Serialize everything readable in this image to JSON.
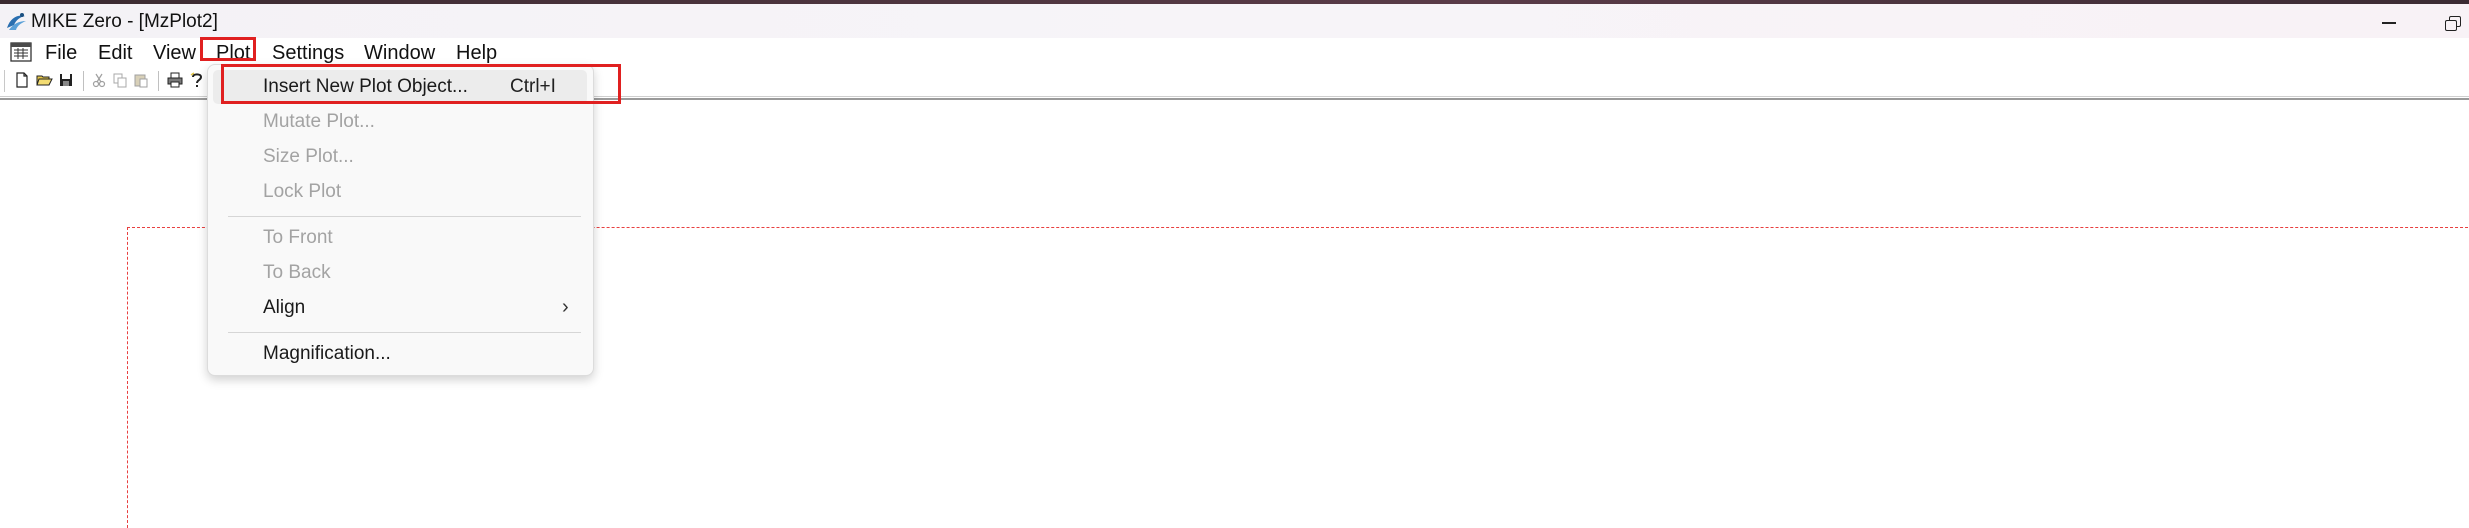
{
  "window": {
    "title": "MIKE Zero - [MzPlot2]"
  },
  "menubar": {
    "items": [
      {
        "label": "File"
      },
      {
        "label": "Edit"
      },
      {
        "label": "View"
      },
      {
        "label": "Plot"
      },
      {
        "label": "Settings"
      },
      {
        "label": "Window"
      },
      {
        "label": "Help"
      }
    ]
  },
  "toolbar": {
    "buttons": [
      "new-document-icon",
      "open-folder-icon",
      "save-icon",
      "cut-icon",
      "copy-icon",
      "paste-icon",
      "print-icon",
      "help-icon"
    ]
  },
  "plot_menu": {
    "items": [
      {
        "label": "Insert New Plot Object...",
        "shortcut": "Ctrl+I",
        "enabled": true
      },
      {
        "label": "Mutate Plot...",
        "enabled": false
      },
      {
        "label": "Size Plot...",
        "enabled": false
      },
      {
        "label": "Lock Plot",
        "enabled": false
      },
      {
        "label": "To Front",
        "enabled": false
      },
      {
        "label": "To Back",
        "enabled": false
      },
      {
        "label": "Align",
        "enabled": true,
        "submenu_arrow": "›"
      },
      {
        "label": "Magnification...",
        "enabled": true
      }
    ]
  },
  "colors": {
    "highlight": "#e02020",
    "plot_frame": "#e84040",
    "disabled_text": "#a3a3a3"
  }
}
